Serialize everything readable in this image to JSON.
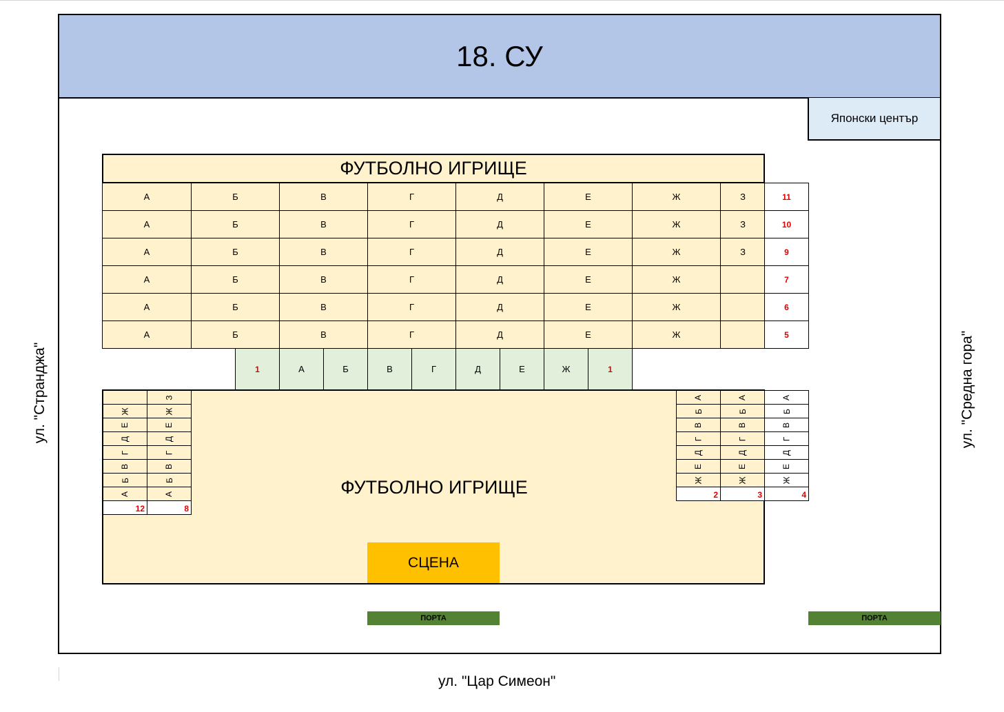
{
  "school": "18. СУ",
  "japan_center": "Японски център",
  "field_title": "ФУТБОЛНО ИГРИЩЕ",
  "stage": "СЦЕНА",
  "gate": "ПОРТА",
  "streets": {
    "left": "ул. \"Странджа\"",
    "right": "ул. \"Средна гора\"",
    "bottom": "ул. \"Цар Симеон\""
  },
  "top_grid": {
    "rows": [
      {
        "cells": [
          "А",
          "Б",
          "В",
          "Г",
          "Д",
          "Е",
          "Ж",
          "З"
        ],
        "grade": "11"
      },
      {
        "cells": [
          "А",
          "Б",
          "В",
          "Г",
          "Д",
          "Е",
          "Ж",
          "З"
        ],
        "grade": "10"
      },
      {
        "cells": [
          "А",
          "Б",
          "В",
          "Г",
          "Д",
          "Е",
          "Ж",
          "З"
        ],
        "grade": "9"
      },
      {
        "cells": [
          "А",
          "Б",
          "В",
          "Г",
          "Д",
          "Е",
          "Ж",
          ""
        ],
        "grade": "7"
      },
      {
        "cells": [
          "А",
          "Б",
          "В",
          "Г",
          "Д",
          "Е",
          "Ж",
          ""
        ],
        "grade": "6"
      },
      {
        "cells": [
          "А",
          "Б",
          "В",
          "Г",
          "Д",
          "Е",
          "Ж",
          ""
        ],
        "grade": "5"
      }
    ]
  },
  "middle_row": {
    "grade_left": "1",
    "cells": [
      "А",
      "Б",
      "В",
      "Г",
      "Д",
      "Е",
      "Ж"
    ],
    "grade_right": "1"
  },
  "left_columns": [
    {
      "cells": [
        "",
        "Ж",
        "Е",
        "Д",
        "Г",
        "В",
        "Б",
        "А"
      ],
      "grade": "12"
    },
    {
      "cells": [
        "З",
        "Ж",
        "Е",
        "Д",
        "Г",
        "В",
        "Б",
        "А"
      ],
      "grade": "8"
    }
  ],
  "right_columns": [
    {
      "cells": [
        "А",
        "Б",
        "В",
        "Г",
        "Д",
        "Е",
        "Ж"
      ],
      "grade": "2"
    },
    {
      "cells": [
        "А",
        "Б",
        "В",
        "Г",
        "Д",
        "Е",
        "Ж"
      ],
      "grade": "3"
    },
    {
      "cells": [
        "А",
        "Б",
        "В",
        "Г",
        "Д",
        "Е",
        "Ж"
      ],
      "grade": "4"
    }
  ],
  "colors": {
    "school": "#b4c6e7",
    "japan_center": "#ddebf7",
    "field": "#fff2cc",
    "first_grade_row": "#e2efda",
    "stage": "#ffc000",
    "gate": "#548235",
    "grade_number": "#e00000"
  }
}
